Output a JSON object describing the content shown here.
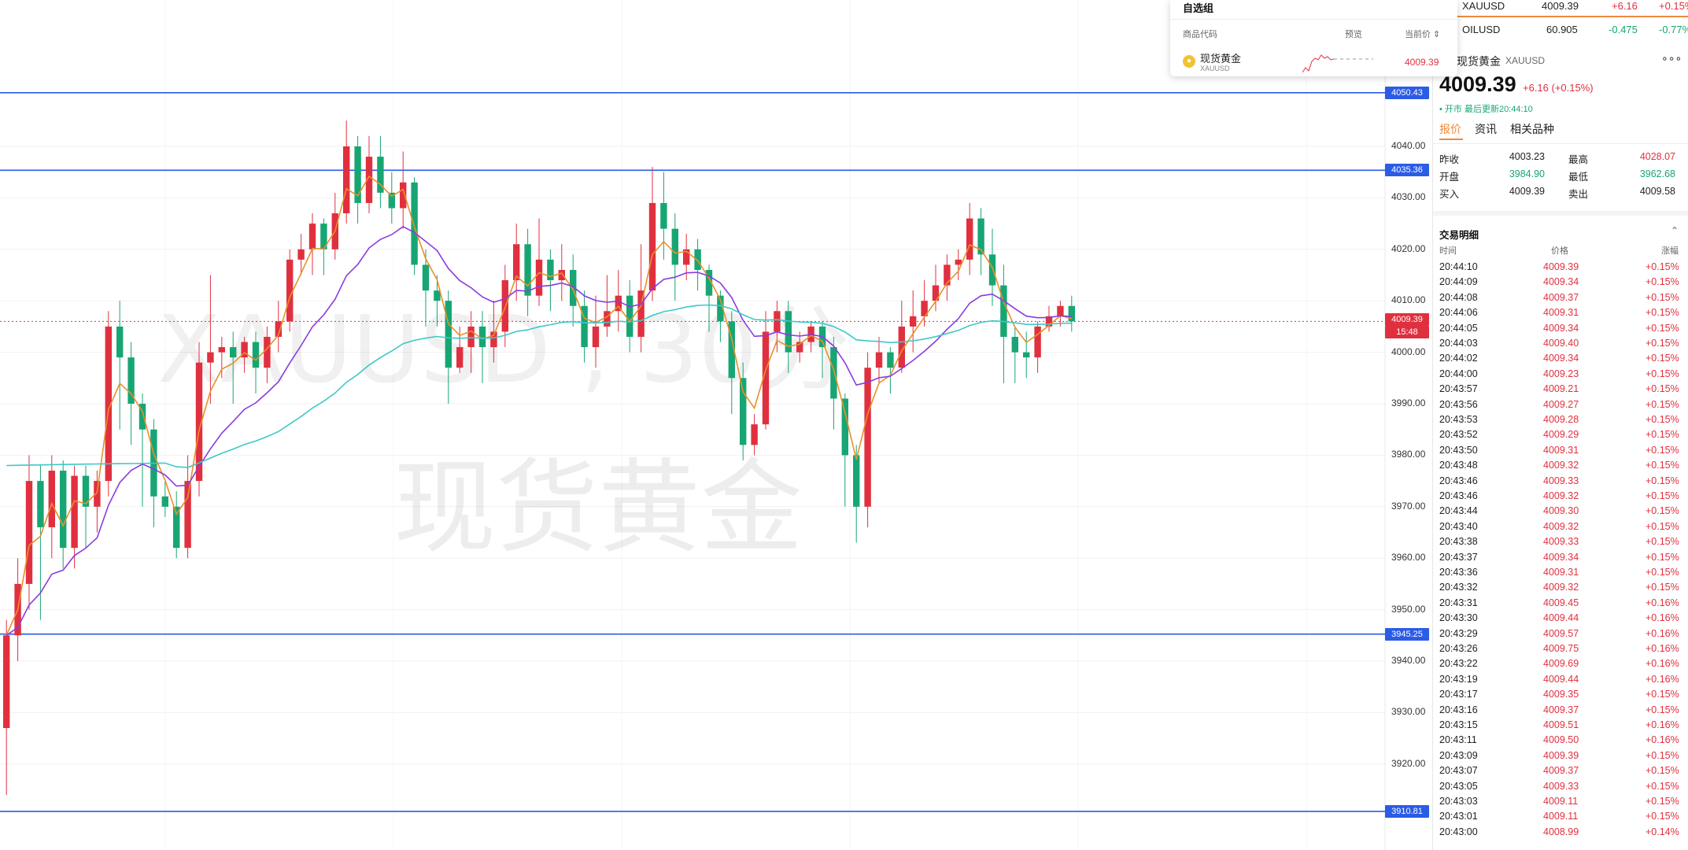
{
  "chart": {
    "watermark_symbol": "XAUUSD , 30分",
    "watermark_name": "现货黄金",
    "colors": {
      "up": "#e0303f",
      "down": "#17a673",
      "hline": "#2b5ce6",
      "ma_fast": "#e8902a",
      "ma_mid": "#8a3ce0",
      "ma_slow": "#3ec8c8"
    },
    "horizontal_lines": [
      {
        "price": 4050.43,
        "label": "4050.43"
      },
      {
        "price": 4035.36,
        "label": "4035.36"
      },
      {
        "price": 3945.25,
        "label": "3945.25"
      },
      {
        "price": 3910.81,
        "label": "3910.81"
      }
    ],
    "current_price_label": "4009.39",
    "countdown_label": "15:48",
    "y_axis_ticks": [
      "4040.00",
      "4030.00",
      "4020.00",
      "4010.00",
      "4000.00",
      "3990.00",
      "3980.00",
      "3970.00",
      "3960.00",
      "3950.00",
      "3940.00",
      "3930.00",
      "3920.00"
    ],
    "y_axis_tick_values": [
      4040,
      4030,
      4020,
      4010,
      4000,
      3990,
      3980,
      3970,
      3960,
      3950,
      3940,
      3930,
      3920
    ]
  },
  "chart_data": {
    "type": "candlestick",
    "symbol": "XAUUSD",
    "ylim": [
      3905,
      4062
    ],
    "candles": [
      [
        3927,
        3945,
        3914,
        3948
      ],
      [
        3945,
        3955,
        3940,
        3960
      ],
      [
        3955,
        3975,
        3950,
        3980
      ],
      [
        3975,
        3966,
        3948,
        3978
      ],
      [
        3966,
        3977,
        3960,
        3980
      ],
      [
        3977,
        3962,
        3958,
        3979
      ],
      [
        3962,
        3976,
        3958,
        3978
      ],
      [
        3976,
        3970,
        3962,
        3978
      ],
      [
        3970,
        3975,
        3965,
        3977
      ],
      [
        3975,
        4005,
        3972,
        4008
      ],
      [
        4005,
        3999,
        3985,
        4010
      ],
      [
        3999,
        3990,
        3982,
        4002
      ],
      [
        3990,
        3985,
        3970,
        3992
      ],
      [
        3985,
        3972,
        3966,
        3987
      ],
      [
        3972,
        3970,
        3968,
        3975
      ],
      [
        3970,
        3962,
        3960,
        3973
      ],
      [
        3962,
        3975,
        3960,
        3980
      ],
      [
        3975,
        3998,
        3972,
        4002
      ],
      [
        3998,
        4000,
        3990,
        4015
      ],
      [
        4000,
        4001,
        3995,
        4003
      ],
      [
        4001,
        3999,
        3990,
        4004
      ],
      [
        3999,
        4002,
        3996,
        4003
      ],
      [
        4002,
        3997,
        3992,
        4004
      ],
      [
        3997,
        4003,
        3994,
        4005
      ],
      [
        4003,
        4006,
        4000,
        4010
      ],
      [
        4006,
        4018,
        4004,
        4020
      ],
      [
        4018,
        4020,
        4015,
        4023
      ],
      [
        4020,
        4025,
        4015,
        4027
      ],
      [
        4025,
        4020,
        4015,
        4026
      ],
      [
        4020,
        4027,
        4018,
        4031
      ],
      [
        4027,
        4040,
        4025,
        4045
      ],
      [
        4040,
        4029,
        4025,
        4042
      ],
      [
        4029,
        4038,
        4027,
        4042
      ],
      [
        4038,
        4031,
        4028,
        4042
      ],
      [
        4031,
        4028,
        4025,
        4035
      ],
      [
        4028,
        4033,
        4024,
        4039
      ],
      [
        4033,
        4017,
        4015,
        4034
      ],
      [
        4017,
        4012,
        4005,
        4020
      ],
      [
        4012,
        4010,
        4005,
        4015
      ],
      [
        4010,
        3997,
        3990,
        4012
      ],
      [
        3997,
        4001,
        3996,
        4005
      ],
      [
        4001,
        4005,
        3996,
        4008
      ],
      [
        4005,
        4001,
        3994,
        4008
      ],
      [
        4001,
        4004,
        3998,
        4010
      ],
      [
        4004,
        4014,
        4001,
        4017
      ],
      [
        4014,
        4021,
        4010,
        4025
      ],
      [
        4021,
        4011,
        4007,
        4024
      ],
      [
        4011,
        4018,
        4009,
        4026
      ],
      [
        4018,
        4014,
        4008,
        4020
      ],
      [
        4014,
        4016,
        4010,
        4021
      ],
      [
        4016,
        4009,
        4005,
        4019
      ],
      [
        4009,
        4001,
        3998,
        4012
      ],
      [
        4001,
        4005,
        3997,
        4011
      ],
      [
        4005,
        4008,
        4003,
        4015
      ],
      [
        4008,
        4011,
        4004,
        4016
      ],
      [
        4011,
        4003,
        4000,
        4014
      ],
      [
        4003,
        4012,
        4000,
        4021
      ],
      [
        4012,
        4029,
        4010,
        4036
      ],
      [
        4029,
        4024,
        4018,
        4035
      ],
      [
        4024,
        4017,
        4010,
        4027
      ],
      [
        4017,
        4020,
        4014,
        4023
      ],
      [
        4020,
        4016,
        4012,
        4022
      ],
      [
        4016,
        4011,
        4004,
        4017
      ],
      [
        4011,
        4006,
        4002,
        4012
      ],
      [
        4006,
        3995,
        3988,
        4008
      ],
      [
        3995,
        3982,
        3979,
        3998
      ],
      [
        3982,
        3986,
        3980,
        3988
      ],
      [
        3986,
        4004,
        3985,
        4008
      ],
      [
        4004,
        4008,
        4000,
        4010
      ],
      [
        4008,
        4000,
        3996,
        4010
      ],
      [
        4000,
        4002,
        3998,
        4004
      ],
      [
        4002,
        4005,
        4000,
        4006
      ],
      [
        4005,
        4001,
        3995,
        4006
      ],
      [
        4001,
        3991,
        3985,
        4003
      ],
      [
        3991,
        3980,
        3970,
        3992
      ],
      [
        3980,
        3970,
        3963,
        3982
      ],
      [
        3970,
        3997,
        3966,
        4000
      ],
      [
        3997,
        4000,
        3994,
        4003
      ],
      [
        4000,
        3997,
        3992,
        4001
      ],
      [
        3997,
        4005,
        3996,
        4010
      ],
      [
        4005,
        4007,
        4000,
        4012
      ],
      [
        4007,
        4010,
        4005,
        4014
      ],
      [
        4010,
        4013,
        4008,
        4017
      ],
      [
        4013,
        4017,
        4010,
        4019
      ],
      [
        4017,
        4018,
        4014,
        4020
      ],
      [
        4018,
        4026,
        4015,
        4029
      ],
      [
        4026,
        4019,
        4015,
        4028
      ],
      [
        4019,
        4013,
        4009,
        4024
      ],
      [
        4013,
        4003,
        3994,
        4017
      ],
      [
        4003,
        4000,
        3994,
        4005
      ],
      [
        4000,
        3999,
        3995,
        4004
      ],
      [
        3999,
        4005,
        3996,
        4006
      ],
      [
        4005,
        4007,
        4004,
        4009
      ],
      [
        4007,
        4009,
        4005,
        4010
      ],
      [
        4009,
        4006,
        4004,
        4011
      ]
    ],
    "moving_averages": [
      "ma_fast",
      "ma_mid",
      "ma_slow"
    ]
  },
  "watchlist": {
    "title": "自选组",
    "col_code": "商品代码",
    "col_preview": "预览",
    "col_price": "当前价 ⇕",
    "item_name": "现货黄金",
    "item_code": "XAUUSD",
    "item_price": "4009.39"
  },
  "tickers": [
    {
      "symbol": "XAUUSD",
      "price": "4009.39",
      "change": "+6.16",
      "pct": "+0.15%",
      "dir": "up"
    },
    {
      "symbol": "OILUSD",
      "price": "60.905",
      "change": "-0.475",
      "pct": "-0.77%",
      "dir": "down"
    }
  ],
  "panel": {
    "name": "现货黄金",
    "code": "XAUUSD",
    "more": "∘∘∘",
    "price": "4009.39",
    "change": "+6.16 (+0.15%)",
    "status": "• 开市  最后更新20:44:10",
    "tabs": [
      "报价",
      "资讯",
      "相关品种"
    ],
    "stats": [
      {
        "label": "昨收",
        "value": "4003.23",
        "label2": "最高",
        "value2": "4028.07"
      },
      {
        "label": "开盘",
        "value": "3984.90",
        "label2": "最低",
        "value2": "3962.68"
      },
      {
        "label": "买入",
        "value": "4009.39",
        "label2": "卖出",
        "value2": "4009.58"
      }
    ],
    "trades_title": "交易明细",
    "trades_cols": [
      "时间",
      "价格",
      "涨幅"
    ],
    "trades": [
      [
        "20:44:10",
        "4009.39",
        "+0.15%"
      ],
      [
        "20:44:09",
        "4009.34",
        "+0.15%"
      ],
      [
        "20:44:08",
        "4009.37",
        "+0.15%"
      ],
      [
        "20:44:06",
        "4009.31",
        "+0.15%"
      ],
      [
        "20:44:05",
        "4009.34",
        "+0.15%"
      ],
      [
        "20:44:03",
        "4009.40",
        "+0.15%"
      ],
      [
        "20:44:02",
        "4009.34",
        "+0.15%"
      ],
      [
        "20:44:00",
        "4009.23",
        "+0.15%"
      ],
      [
        "20:43:57",
        "4009.21",
        "+0.15%"
      ],
      [
        "20:43:56",
        "4009.27",
        "+0.15%"
      ],
      [
        "20:43:53",
        "4009.28",
        "+0.15%"
      ],
      [
        "20:43:52",
        "4009.29",
        "+0.15%"
      ],
      [
        "20:43:50",
        "4009.31",
        "+0.15%"
      ],
      [
        "20:43:48",
        "4009.32",
        "+0.15%"
      ],
      [
        "20:43:46",
        "4009.33",
        "+0.15%"
      ],
      [
        "20:43:46",
        "4009.32",
        "+0.15%"
      ],
      [
        "20:43:44",
        "4009.30",
        "+0.15%"
      ],
      [
        "20:43:40",
        "4009.32",
        "+0.15%"
      ],
      [
        "20:43:38",
        "4009.33",
        "+0.15%"
      ],
      [
        "20:43:37",
        "4009.34",
        "+0.15%"
      ],
      [
        "20:43:36",
        "4009.31",
        "+0.15%"
      ],
      [
        "20:43:32",
        "4009.32",
        "+0.15%"
      ],
      [
        "20:43:31",
        "4009.45",
        "+0.16%"
      ],
      [
        "20:43:30",
        "4009.44",
        "+0.16%"
      ],
      [
        "20:43:29",
        "4009.57",
        "+0.16%"
      ],
      [
        "20:43:26",
        "4009.75",
        "+0.16%"
      ],
      [
        "20:43:22",
        "4009.69",
        "+0.16%"
      ],
      [
        "20:43:19",
        "4009.44",
        "+0.16%"
      ],
      [
        "20:43:17",
        "4009.35",
        "+0.15%"
      ],
      [
        "20:43:16",
        "4009.37",
        "+0.15%"
      ],
      [
        "20:43:15",
        "4009.51",
        "+0.16%"
      ],
      [
        "20:43:11",
        "4009.50",
        "+0.16%"
      ],
      [
        "20:43:09",
        "4009.39",
        "+0.15%"
      ],
      [
        "20:43:07",
        "4009.37",
        "+0.15%"
      ],
      [
        "20:43:05",
        "4009.33",
        "+0.15%"
      ],
      [
        "20:43:03",
        "4009.11",
        "+0.15%"
      ],
      [
        "20:43:01",
        "4009.11",
        "+0.15%"
      ],
      [
        "20:43:00",
        "4008.99",
        "+0.14%"
      ]
    ]
  }
}
